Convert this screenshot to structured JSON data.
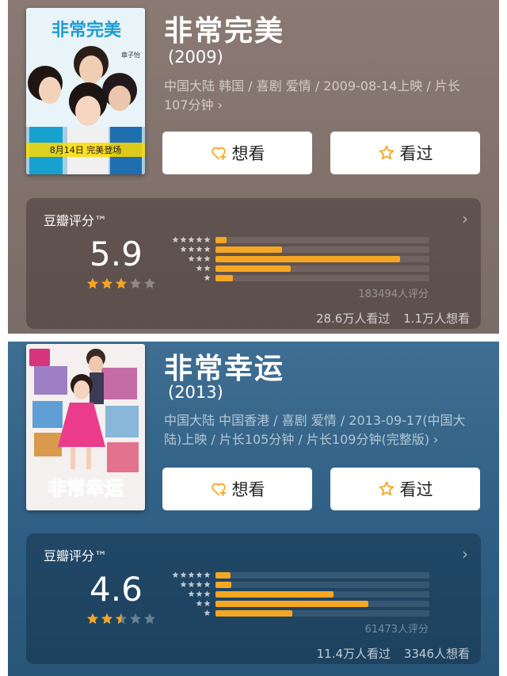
{
  "movies": [
    {
      "title": "非常完美",
      "year": "(2009)",
      "meta": "中国大陆 韩国 / 喜剧 爱情 / 2009-08-14上映 / 片长107分钟 ›",
      "want_label": "想看",
      "seen_label": "看过",
      "rating_label": "豆瓣评分™",
      "score": "5.9",
      "stars_level": 3,
      "distribution": [
        1.5,
        8.7,
        24.2,
        9.9,
        2.3
      ],
      "rating_count": "183494人评分",
      "watched": "28.6万人看过",
      "wished": "1.1万人想看",
      "poster": {
        "logo": "非常完美",
        "cast": "章子怡",
        "date_text": "8月14日 完美登场"
      }
    },
    {
      "title": "非常幸运",
      "year": "(2013)",
      "meta": "中国大陆 中国香港 / 喜剧 爱情 / 2013-09-17(中国大陆)上映 / 片长105分钟 / 片长109分钟(完整版) ›",
      "want_label": "想看",
      "seen_label": "看过",
      "rating_label": "豆瓣评分™",
      "score": "4.6",
      "stars_level": 2.5,
      "distribution": [
        2.0,
        2.1,
        15.4,
        20.0,
        10.1
      ],
      "rating_count": "61473人评分",
      "watched": "11.4万人看过",
      "wished": "3346人想看",
      "poster": {
        "logo": "非常幸运"
      }
    }
  ],
  "colors": {
    "accent": "#f5a623",
    "card0_bg": "#857670",
    "card1_bg": "#336286"
  }
}
